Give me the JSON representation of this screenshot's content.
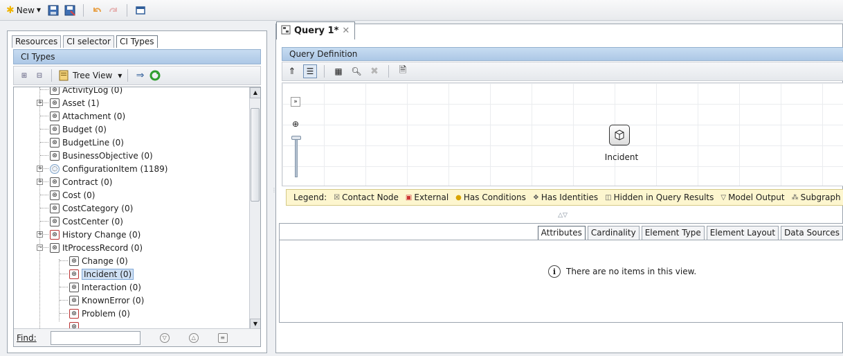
{
  "toolbar": {
    "new_label": "New"
  },
  "left_panel": {
    "tabs": [
      "Resources",
      "CI selector",
      "CI Types"
    ],
    "active_tab": "CI Types",
    "header": "CI Types",
    "tree_view_label": "Tree View",
    "find_label": "Find:",
    "find_value": "",
    "tree": [
      {
        "label": "ActivityLog (0)",
        "icon": "cube-icon"
      },
      {
        "label": "Asset (1)",
        "icon": "cube-icon",
        "expandable": true
      },
      {
        "label": "Attachment (0)",
        "icon": "cube-icon"
      },
      {
        "label": "Budget (0)",
        "icon": "cube-icon"
      },
      {
        "label": "BudgetLine (0)",
        "icon": "cube-icon"
      },
      {
        "label": "BusinessObjective (0)",
        "icon": "cube-icon"
      },
      {
        "label": "ConfigurationItem (1189)",
        "icon": "ci-icon",
        "expandable": true
      },
      {
        "label": "Contract (0)",
        "icon": "cube-icon",
        "expandable": true
      },
      {
        "label": "Cost (0)",
        "icon": "cube-icon"
      },
      {
        "label": "CostCategory (0)",
        "icon": "cube-icon"
      },
      {
        "label": "CostCenter (0)",
        "icon": "cube-icon"
      },
      {
        "label": "History Change (0)",
        "icon": "red-cube-icon",
        "expandable": true
      },
      {
        "label": "ItProcessRecord (0)",
        "icon": "cube-icon",
        "expanded": true
      },
      {
        "label": "Change (0)",
        "icon": "cube-icon",
        "child": true
      },
      {
        "label": "Incident (0)",
        "icon": "red-cube-icon",
        "child": true,
        "selected": true
      },
      {
        "label": "Interaction (0)",
        "icon": "cube-icon",
        "child": true
      },
      {
        "label": "KnownError (0)",
        "icon": "cube-icon",
        "child": true
      },
      {
        "label": "Problem (0)",
        "icon": "red-cube-icon",
        "child": true
      }
    ]
  },
  "right_panel": {
    "query_tab": "Query  1*",
    "query_definition": "Query Definition",
    "node_label": "Incident",
    "legend_label": "Legend:",
    "legend_items": [
      "Contact Node",
      "External",
      "Has Conditions",
      "Has Identities",
      "Hidden in Query Results",
      "Model Output",
      "Subgraph"
    ],
    "bottom_tabs": [
      "Attributes",
      "Cardinality",
      "Element Type",
      "Element Layout",
      "Data Sources"
    ],
    "active_bottom_tab": "Attributes",
    "empty_message": "There are no items in this view."
  },
  "colors": {
    "header_blue": "#adc8e6",
    "legend_yellow": "#fdf6cf",
    "selection": "#cfe0f4",
    "new_star": "#f0b400"
  }
}
